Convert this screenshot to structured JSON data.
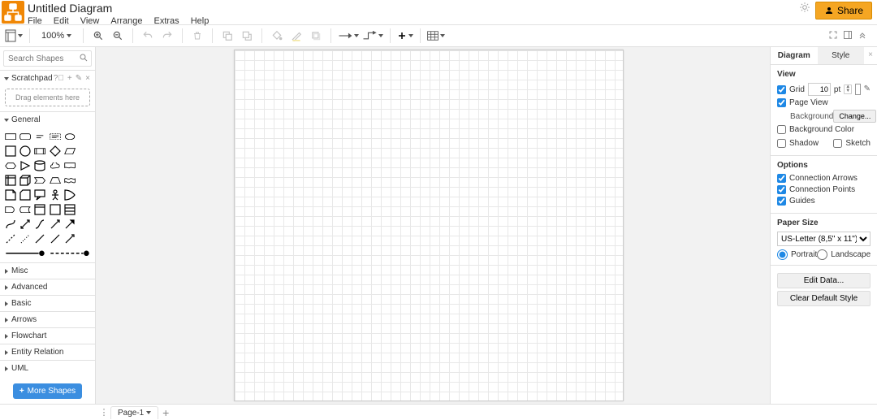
{
  "header": {
    "doc_title": "Untitled Diagram",
    "menu": [
      "File",
      "Edit",
      "View",
      "Arrange",
      "Extras",
      "Help"
    ],
    "share_label": "Share"
  },
  "toolbar": {
    "zoom_label": "100%"
  },
  "left": {
    "search_placeholder": "Search Shapes",
    "scratchpad_label": "Scratchpad",
    "scratchpad_drop_hint": "Drag elements here",
    "general_label": "General",
    "more_shapes_label": "More Shapes",
    "categories": [
      "Misc",
      "Advanced",
      "Basic",
      "Arrows",
      "Flowchart",
      "Entity Relation",
      "UML"
    ]
  },
  "right": {
    "tabs": {
      "diagram": "Diagram",
      "style": "Style"
    },
    "view": {
      "title": "View",
      "grid_label": "Grid",
      "grid_value": "10",
      "grid_unit": "pt",
      "page_view_label": "Page View",
      "background_label": "Background",
      "change_label": "Change...",
      "background_color_label": "Background Color",
      "shadow_label": "Shadow",
      "sketch_label": "Sketch"
    },
    "options": {
      "title": "Options",
      "connection_arrows": "Connection Arrows",
      "connection_points": "Connection Points",
      "guides": "Guides"
    },
    "paper": {
      "title": "Paper Size",
      "selected": "US-Letter (8,5\" x 11\")",
      "portrait": "Portrait",
      "landscape": "Landscape"
    },
    "buttons": {
      "edit_data": "Edit Data...",
      "clear_default": "Clear Default Style"
    }
  },
  "footer": {
    "page_label": "Page-1"
  },
  "colors": {
    "accent_orange": "#f08705",
    "accent_blue": "#3b8ee0",
    "check_blue": "#1e88e5"
  }
}
